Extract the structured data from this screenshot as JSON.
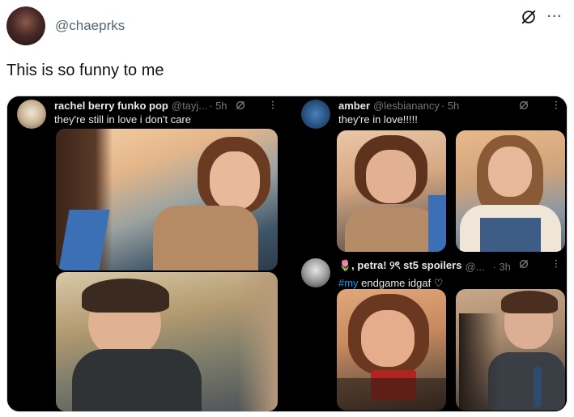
{
  "tweet": {
    "handle": "@chaeprks",
    "text": "This is so funny to me"
  },
  "icons": {
    "grok": "grok-icon",
    "more": "more-icon"
  },
  "quotes": [
    {
      "name": "rachel berry funko pop",
      "username": "@tayj...",
      "time": "· 5h",
      "text": "they're still in love i don't care"
    },
    {
      "name": "amber",
      "username": "@lesbianancy",
      "time": "· 5h",
      "text": "they're in love!!!!!"
    },
    {
      "name": "🌷, petra! ୨ৎ st5 spoilers",
      "username": "@...",
      "time": "· 3h",
      "hashtag": "#my",
      "text": " endgame idgaf ♡"
    }
  ],
  "colors": {
    "accent": "#1d9bf0",
    "muted": "#536471",
    "dark_bg": "#000000"
  }
}
